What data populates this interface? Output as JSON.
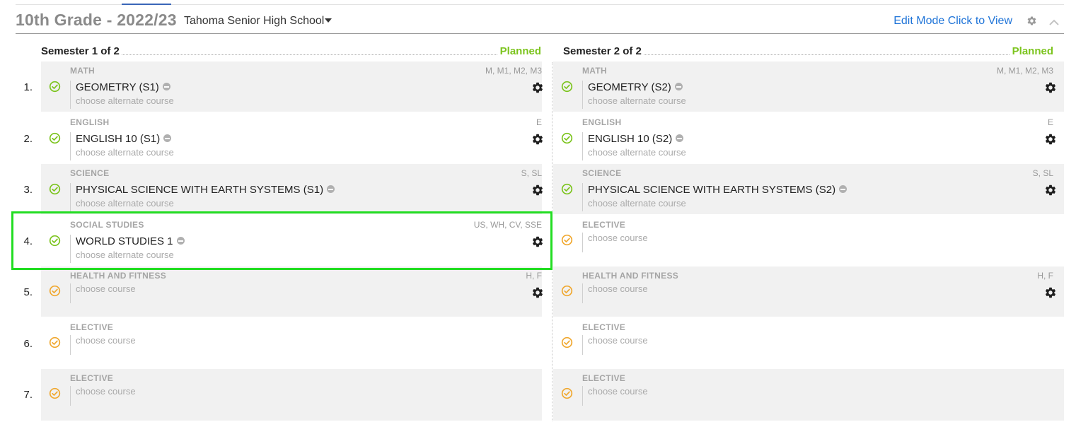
{
  "header": {
    "title": "10th Grade - 2022/23",
    "school": "Tahoma Senior High School",
    "edit_link": "Edit Mode Click to View"
  },
  "semesters": [
    {
      "title": "Semester 1 of 2",
      "status": "Planned"
    },
    {
      "title": "Semester 2 of 2",
      "status": "Planned"
    }
  ],
  "colors": {
    "planned": "#7cc41e",
    "complete": "#7cc41e",
    "pending": "#f0a830",
    "link": "#1f74d8",
    "highlight": "#22dd22"
  },
  "rows": [
    {
      "num": "1.",
      "s1": {
        "subject": "MATH",
        "codes": "M, M1, M2, M3",
        "course": "GEOMETRY (S1)",
        "alt": "choose alternate course",
        "status": "complete"
      },
      "s2": {
        "subject": "MATH",
        "codes": "M, M1, M2, M3",
        "course": "GEOMETRY (S2)",
        "alt": "choose alternate course",
        "status": "complete"
      }
    },
    {
      "num": "2.",
      "s1": {
        "subject": "ENGLISH",
        "codes": "E",
        "course": "ENGLISH 10 (S1)",
        "alt": "choose alternate course",
        "status": "complete"
      },
      "s2": {
        "subject": "ENGLISH",
        "codes": "E",
        "course": "ENGLISH 10 (S2)",
        "alt": "choose alternate course",
        "status": "complete"
      }
    },
    {
      "num": "3.",
      "s1": {
        "subject": "SCIENCE",
        "codes": "S, SL",
        "course": "PHYSICAL SCIENCE WITH EARTH SYSTEMS (S1)",
        "alt": "choose alternate course",
        "status": "complete"
      },
      "s2": {
        "subject": "SCIENCE",
        "codes": "S, SL",
        "course": "PHYSICAL SCIENCE WITH EARTH SYSTEMS (S2)",
        "alt": "choose alternate course",
        "status": "complete"
      }
    },
    {
      "num": "4.",
      "s1": {
        "subject": "SOCIAL STUDIES",
        "codes": "US, WH, CV, SSE",
        "course": "WORLD STUDIES 1",
        "alt": "choose alternate course",
        "status": "complete"
      },
      "s2": {
        "subject": "ELECTIVE",
        "codes": "",
        "course": "",
        "alt": "choose course",
        "status": "pending"
      }
    },
    {
      "num": "5.",
      "s1": {
        "subject": "HEALTH AND FITNESS",
        "codes": "H, F",
        "course": "",
        "alt": "choose course",
        "status": "pending"
      },
      "s2": {
        "subject": "HEALTH AND FITNESS",
        "codes": "H, F",
        "course": "",
        "alt": "choose course",
        "status": "pending"
      }
    },
    {
      "num": "6.",
      "s1": {
        "subject": "ELECTIVE",
        "codes": "",
        "course": "",
        "alt": "choose course",
        "status": "pending"
      },
      "s2": {
        "subject": "ELECTIVE",
        "codes": "",
        "course": "",
        "alt": "choose course",
        "status": "pending"
      }
    },
    {
      "num": "7.",
      "s1": {
        "subject": "ELECTIVE",
        "codes": "",
        "course": "",
        "alt": "choose course",
        "status": "pending"
      },
      "s2": {
        "subject": "ELECTIVE",
        "codes": "",
        "course": "",
        "alt": "choose course",
        "status": "pending"
      }
    }
  ]
}
